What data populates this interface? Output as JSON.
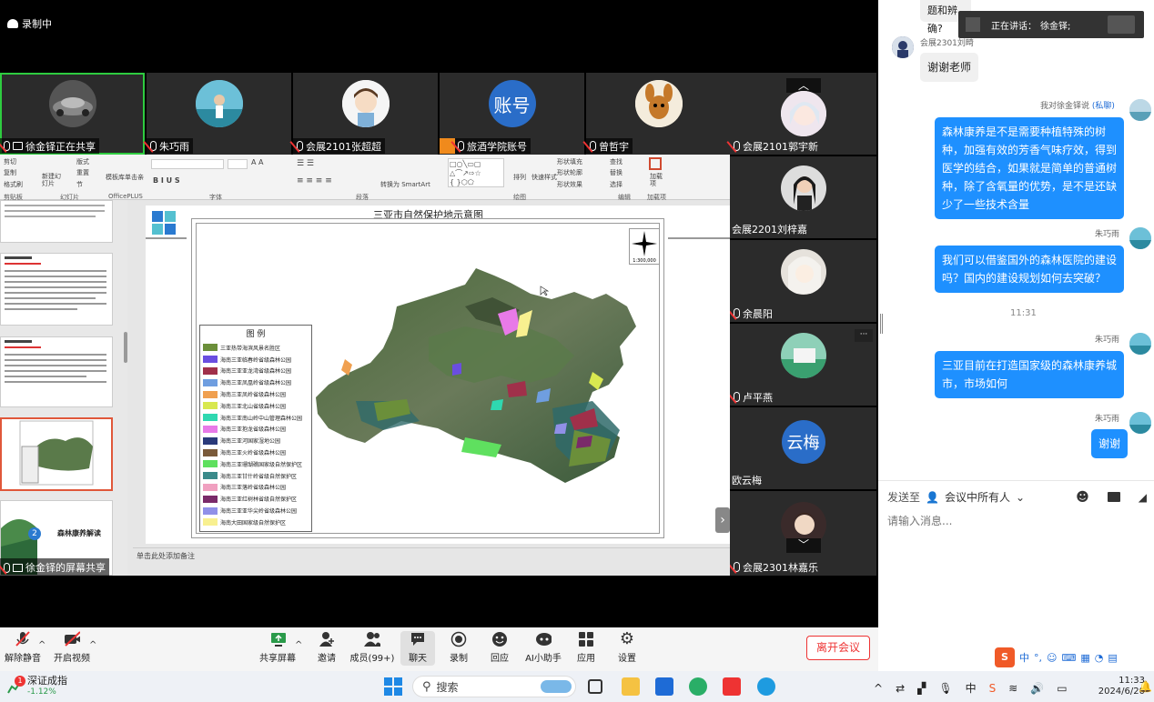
{
  "recording": {
    "label": "录制中"
  },
  "participants": [
    {
      "name": "徐金铎正在共享",
      "avatar": "car"
    },
    {
      "name": "朱巧雨",
      "avatar": "photo"
    },
    {
      "name": "会展2101张超超",
      "avatar": "cartoon"
    },
    {
      "name": "旅酒学院账号",
      "avatar": "text",
      "avatar_text": "账号"
    },
    {
      "name": "曾哲宇",
      "avatar": "cartoon"
    },
    {
      "name": "会展2101郭宇新",
      "avatar": "anime"
    }
  ],
  "side_participants": [
    {
      "name": "会展2201刘梓嘉"
    },
    {
      "name": "余晨阳"
    },
    {
      "name": "卢平燕"
    },
    {
      "name": "欧云梅",
      "avatar_text": "云梅"
    },
    {
      "name": "会展2301林嘉乐"
    }
  ],
  "ppt": {
    "ribbon_groups": [
      "剪贴板",
      "幻灯片",
      "OfficePLUS",
      "字体",
      "段落",
      "绘图",
      "编辑",
      "加载项"
    ],
    "ribbon_buttons": [
      "剪切",
      "复制",
      "格式刷",
      "新建幻灯片",
      "版式",
      "重置",
      "节",
      "模板库",
      "单击亲",
      "转换为 SmartArt",
      "排列",
      "快速样式",
      "形状填充",
      "形状轮廓",
      "形状效果",
      "查找",
      "替换",
      "选择",
      "加载项"
    ],
    "map_title": "三亚市自然保护地示意图",
    "scale": "1:300,000",
    "legend_title": "图 例",
    "legend": [
      {
        "label": "三亚热带海滨风景名胜区",
        "color": "#6b8f3a"
      },
      {
        "label": "海南三亚临春岭省级森林公园",
        "color": "#6a4ee0"
      },
      {
        "label": "海南三亚亚龙湾省级森林公园",
        "color": "#a0304a"
      },
      {
        "label": "海南三亚凤凰岭省级森林公园",
        "color": "#6f9ee0"
      },
      {
        "label": "海南三亚凤岭省级森林公园",
        "color": "#f0a050"
      },
      {
        "label": "海南三亚北山省级森林公园",
        "color": "#d8e850"
      },
      {
        "label": "海南三亚南山岭中山管理森林公园",
        "color": "#2fd8b0"
      },
      {
        "label": "海南三亚抱龙省级森林公园",
        "color": "#e87ae8"
      },
      {
        "label": "海南三亚河国家湿地公园",
        "color": "#2a3a7a"
      },
      {
        "label": "海南三亚火岭省级森林公园",
        "color": "#7a5a3a"
      },
      {
        "label": "海南三亚珊瑚礁国家级自然保护区",
        "color": "#5fe05f"
      },
      {
        "label": "海南三亚甘什岭省级自然保护区",
        "color": "#3a8a8a"
      },
      {
        "label": "海南三亚落岭省级森林公园",
        "color": "#f0a0c0"
      },
      {
        "label": "海南三亚红树林省级自然保护区",
        "color": "#7a2a6a"
      },
      {
        "label": "海南三亚亚华尖岭省级森林公园",
        "color": "#9090e8"
      },
      {
        "label": "海南大田国家级自然保护区",
        "color": "#f8f090"
      }
    ],
    "thumb_title": "森林康养解读",
    "thumb_number": "2",
    "note_placeholder": "单击此处添加备注"
  },
  "share_bar": {
    "label": "徐金铎的屏幕共享"
  },
  "toolbar": {
    "items": [
      {
        "label": "解除静音",
        "icon": "mic-muted-icon"
      },
      {
        "label": "开启视频",
        "icon": "camera-off-icon"
      },
      {
        "label": "共享屏幕",
        "icon": "screen-share-icon"
      },
      {
        "label": "邀请",
        "icon": "invite-icon"
      },
      {
        "label": "成员(99+)",
        "icon": "members-icon"
      },
      {
        "label": "聊天",
        "icon": "chat-icon"
      },
      {
        "label": "录制",
        "icon": "record-icon"
      },
      {
        "label": "回应",
        "icon": "reaction-icon"
      },
      {
        "label": "AI小助手",
        "icon": "ai-assistant-icon"
      },
      {
        "label": "应用",
        "icon": "apps-icon"
      },
      {
        "label": "设置",
        "icon": "settings-icon"
      }
    ],
    "leave_label": "离开会议"
  },
  "chat": {
    "speaking_label": "正在讲话：",
    "speaking_name": "徐金铎;",
    "top_cut_text": "题和辨确?",
    "messages": [
      {
        "sender": "会展2301刘畸",
        "text": "谢谢老师",
        "direction": "in"
      },
      {
        "sender": "我对徐金铎说",
        "private": "(私聊)",
        "text": "森林康养是不是需要种植特殊的树种，加强有效的芳香气味疗效，得到医学的结合，如果就是简单的普通树种，除了含氧量的优势，是不是还缺少了一些技术含量",
        "direction": "out"
      },
      {
        "sender": "朱巧雨",
        "text": "我们可以借鉴国外的森林医院的建设吗？国内的建设规划如何去突破？",
        "direction": "out"
      },
      {
        "sender": "朱巧雨",
        "text": "三亚目前在打造国家级的森林康养城市，市场如何",
        "direction": "out"
      },
      {
        "sender": "朱巧雨",
        "text": "谢谢",
        "direction": "out"
      }
    ],
    "time_divider": "11:31",
    "send_to_label": "发送至",
    "send_to_target": "会议中所有人",
    "input_placeholder": "请输入消息..."
  },
  "ime": {
    "items": [
      "中",
      "°,",
      "☺",
      "⌨"
    ]
  },
  "taskbar": {
    "stock_name": "深证成指",
    "stock_change": "-1.12%",
    "stock_badge": "1",
    "search_placeholder": "搜索",
    "tray_text": "中",
    "time": "11:33",
    "date": "2024/6/20"
  }
}
